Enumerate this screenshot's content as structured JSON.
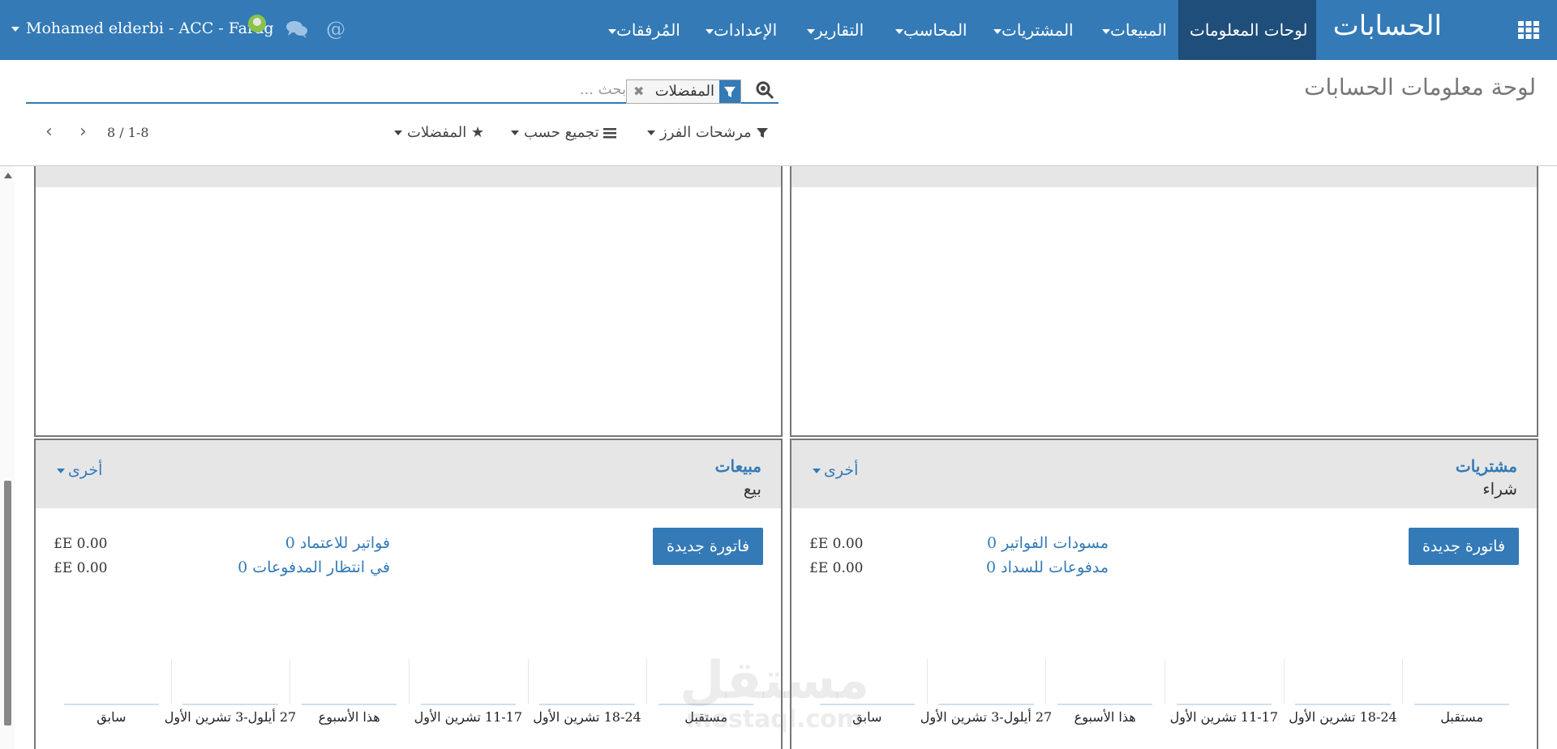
{
  "navbar": {
    "app_name": "الحسابات",
    "menu": [
      {
        "label": "لوحات المعلومات",
        "active": true,
        "has_caret": false
      },
      {
        "label": "المبيعات",
        "has_caret": true
      },
      {
        "label": "المشتريات",
        "has_caret": true
      },
      {
        "label": "المحاسب",
        "has_caret": true
      },
      {
        "label": "التقارير",
        "has_caret": true
      },
      {
        "label": "الإعدادات",
        "has_caret": true
      },
      {
        "label": "المُرفقات",
        "has_caret": true
      }
    ],
    "user": "Mohamed elderbi - ACC - Farag",
    "at_symbol": "@",
    "icons": {
      "apps": "grid-icon",
      "chat": "chat-icon",
      "avatar": "user-avatar",
      "mention": "at-icon"
    }
  },
  "control_panel": {
    "title": "لوحة معلومات الحسابات",
    "search": {
      "facet": "المفضلات",
      "placeholder": "بحث ..."
    },
    "filters_label": "مرشحات الفرز",
    "group_by_label": "تجميع حسب",
    "favorites_label": "المفضلات",
    "pager": "8 / 1-8"
  },
  "cards": [
    {
      "title": "مشتريات",
      "subtitle": "شراء",
      "other": "أخرى",
      "button": "فاتورة جديدة",
      "lines": [
        {
          "label": "0 مسودات الفواتير",
          "amount": "£E 0.00"
        },
        {
          "label": "0 مدفوعات للسداد",
          "amount": "£E 0.00"
        }
      ],
      "ticks": [
        "مستقبل",
        "18-24 تشرين الأول",
        "11-17 تشرين الأول",
        "هذا الأسبوع",
        "27 أيلول-3 تشرين الأول",
        "سابق"
      ]
    },
    {
      "title": "مبيعات",
      "subtitle": "بيع",
      "other": "أخرى",
      "button": "فاتورة جديدة",
      "lines": [
        {
          "label": "0 فواتير للاعتماد",
          "amount": "£E 0.00"
        },
        {
          "label": "0 في انتظار المدفوعات",
          "amount": "£E 0.00"
        }
      ],
      "ticks": [
        "مستقبل",
        "18-24 تشرين الأول",
        "11-17 تشرين الأول",
        "هذا الأسبوع",
        "27 أيلول-3 تشرين الأول",
        "سابق"
      ]
    }
  ],
  "watermark": {
    "line1": "مستقل",
    "line2": "mostaql.com"
  },
  "colors": {
    "primary": "#337ab7",
    "primary_dark": "#1e4e79",
    "card_header": "#e6e6e6"
  }
}
